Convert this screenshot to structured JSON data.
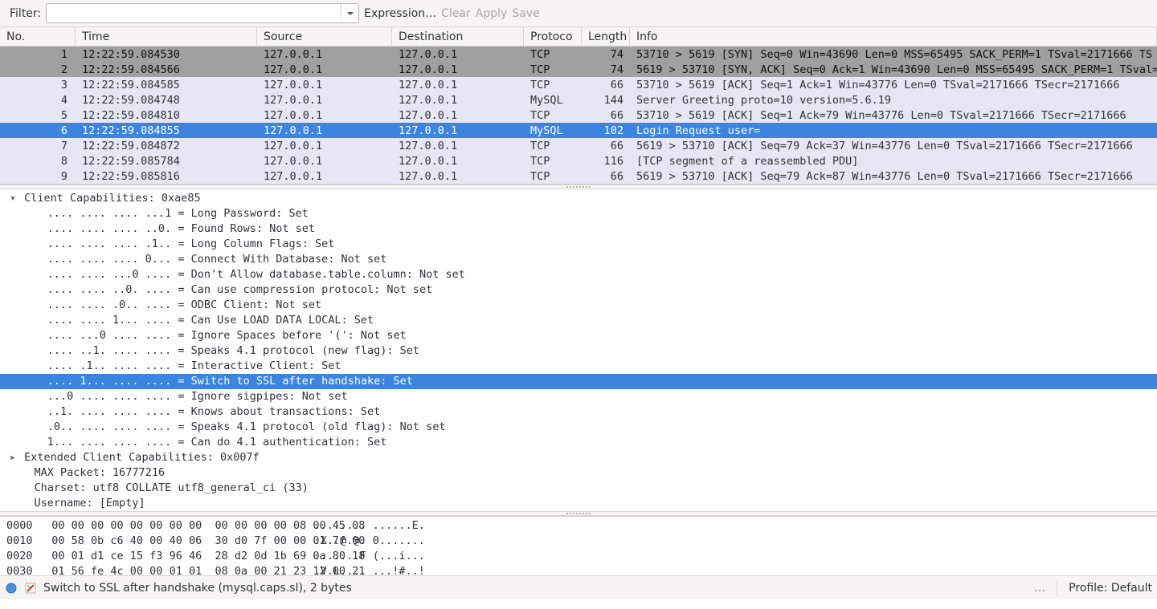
{
  "toolbar": {
    "filter_label": "Filter:",
    "filter_value": "",
    "expression": "Expression…",
    "clear": "Clear",
    "apply": "Apply",
    "save": "Save"
  },
  "columns": {
    "no": "No.",
    "time": "Time",
    "source": "Source",
    "destination": "Destination",
    "protocol": "Protoco",
    "length": "Length",
    "info": "Info"
  },
  "packets": [
    {
      "no": "1",
      "time": "12:22:59.084530",
      "src": "127.0.0.1",
      "dst": "127.0.0.1",
      "proto": "TCP",
      "len": "74",
      "info": "53710 > 5619 [SYN] Seq=0 Win=43690 Len=0 MSS=65495 SACK_PERM=1 TSval=2171666 TS",
      "cls": "gray"
    },
    {
      "no": "2",
      "time": "12:22:59.084566",
      "src": "127.0.0.1",
      "dst": "127.0.0.1",
      "proto": "TCP",
      "len": "74",
      "info": "5619 > 53710 [SYN, ACK] Seq=0 Ack=1 Win=43690 Len=0 MSS=65495 SACK_PERM=1 TSval=",
      "cls": "gray"
    },
    {
      "no": "3",
      "time": "12:22:59.084585",
      "src": "127.0.0.1",
      "dst": "127.0.0.1",
      "proto": "TCP",
      "len": "66",
      "info": "53710 > 5619 [ACK] Seq=1 Ack=1 Win=43776 Len=0 TSval=2171666 TSecr=2171666",
      "cls": "lav"
    },
    {
      "no": "4",
      "time": "12:22:59.084748",
      "src": "127.0.0.1",
      "dst": "127.0.0.1",
      "proto": "MySQL",
      "len": "144",
      "info": "Server Greeting proto=10 version=5.6.19",
      "cls": "lav"
    },
    {
      "no": "5",
      "time": "12:22:59.084810",
      "src": "127.0.0.1",
      "dst": "127.0.0.1",
      "proto": "TCP",
      "len": "66",
      "info": "53710 > 5619 [ACK] Seq=1 Ack=79 Win=43776 Len=0 TSval=2171666 TSecr=2171666",
      "cls": "lav"
    },
    {
      "no": "6",
      "time": "12:22:59.084855",
      "src": "127.0.0.1",
      "dst": "127.0.0.1",
      "proto": "MySQL",
      "len": "102",
      "info": "Login Request user=",
      "cls": "sel"
    },
    {
      "no": "7",
      "time": "12:22:59.084872",
      "src": "127.0.0.1",
      "dst": "127.0.0.1",
      "proto": "TCP",
      "len": "66",
      "info": "5619 > 53710 [ACK] Seq=79 Ack=37 Win=43776 Len=0 TSval=2171666 TSecr=2171666",
      "cls": "lav"
    },
    {
      "no": "8",
      "time": "12:22:59.085784",
      "src": "127.0.0.1",
      "dst": "127.0.0.1",
      "proto": "TCP",
      "len": "116",
      "info": "[TCP segment of a reassembled PDU]",
      "cls": "lav"
    },
    {
      "no": "9",
      "time": "12:22:59.085816",
      "src": "127.0.0.1",
      "dst": "127.0.0.1",
      "proto": "TCP",
      "len": "66",
      "info": "5619 > 53710 [ACK] Seq=79 Ack=87 Win=43776 Len=0 TSval=2171666 TSecr=2171666",
      "cls": "lav"
    }
  ],
  "details": {
    "head": "Client Capabilities: 0xae85",
    "rows": [
      ".... .... .... ...1 = Long Password: Set",
      ".... .... .... ..0. = Found Rows: Not set",
      ".... .... .... .1.. = Long Column Flags: Set",
      ".... .... .... 0... = Connect With Database: Not set",
      ".... .... ...0 .... = Don't Allow database.table.column: Not set",
      ".... .... ..0. .... = Can use compression protocol: Not set",
      ".... .... .0.. .... = ODBC Client: Not set",
      ".... .... 1... .... = Can Use LOAD DATA LOCAL: Set",
      ".... ...0 .... .... = Ignore Spaces before '(': Not set",
      ".... ..1. .... .... = Speaks 4.1 protocol (new flag): Set",
      ".... .1.. .... .... = Interactive Client: Set",
      ".... 1... .... .... = Switch to SSL after handshake: Set",
      "...0 .... .... .... = Ignore sigpipes: Not set",
      "..1. .... .... .... = Knows about transactions: Set",
      ".0.. .... .... .... = Speaks 4.1 protocol (old flag): Not set",
      "1... .... .... .... = Can do 4.1 authentication: Set"
    ],
    "selected_index": 11,
    "ext": "Extended Client Capabilities: 0x007f",
    "max": "MAX Packet: 16777216",
    "charset": "Charset: utf8 COLLATE utf8_general_ci (33)",
    "user": "Username: [Empty]"
  },
  "hex": [
    {
      "off": "0000",
      "b": "00 00 00 00 00 00 00 00  00 00 00 00 08 00 45 08",
      "a": "........ ......E."
    },
    {
      "off": "0010",
      "b": "00 58 0b c6 40 00 40 06  30 d0 7f 00 00 01 7f 00",
      "a": ".X..@.@. 0......."
    },
    {
      "off": "0020",
      "b": "00 01 d1 ce 15 f3 96 46  28 d2 0d 1b 69 0a 80 18",
      "a": ".......F (...i..."
    },
    {
      "off": "0030",
      "b": "01 56 fe 4c 00 00 01 01  08 0a 00 21 23 12 00 21",
      "a": ".V.L.... ...!#..!"
    }
  ],
  "status": {
    "field": "Switch to SSL after handshake (mysql.caps.sl), 2 bytes",
    "dots": "…",
    "profile": "Profile: Default"
  }
}
